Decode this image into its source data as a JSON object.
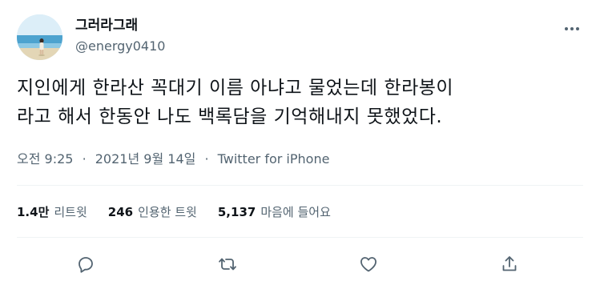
{
  "user": {
    "display_name": "그러라그래",
    "handle": "@energy0410",
    "avatar_icon": "beach-photo"
  },
  "tweet": {
    "text_lines": [
      "지인에게 한라산 꼭대기 이름 아냐고 물었는데 한라봉이",
      "라고 해서 한동안 나도 백록담을 기억해내지 못했었다."
    ],
    "time": "오전 9:25",
    "separator": "·",
    "date": "2021년 9월 14일",
    "source": "Twitter for iPhone"
  },
  "stats": {
    "retweets": {
      "count": "1.4만",
      "label": "리트윗"
    },
    "quotes": {
      "count": "246",
      "label": "인용한 트윗"
    },
    "likes": {
      "count": "5,137",
      "label": "마음에 들어요"
    }
  },
  "actions": {
    "reply_icon": "reply-icon",
    "retweet_icon": "retweet-icon",
    "like_icon": "heart-icon",
    "share_icon": "share-icon"
  },
  "colors": {
    "text": "#0f1419",
    "secondary": "#536471",
    "divider": "#eff3f4"
  }
}
